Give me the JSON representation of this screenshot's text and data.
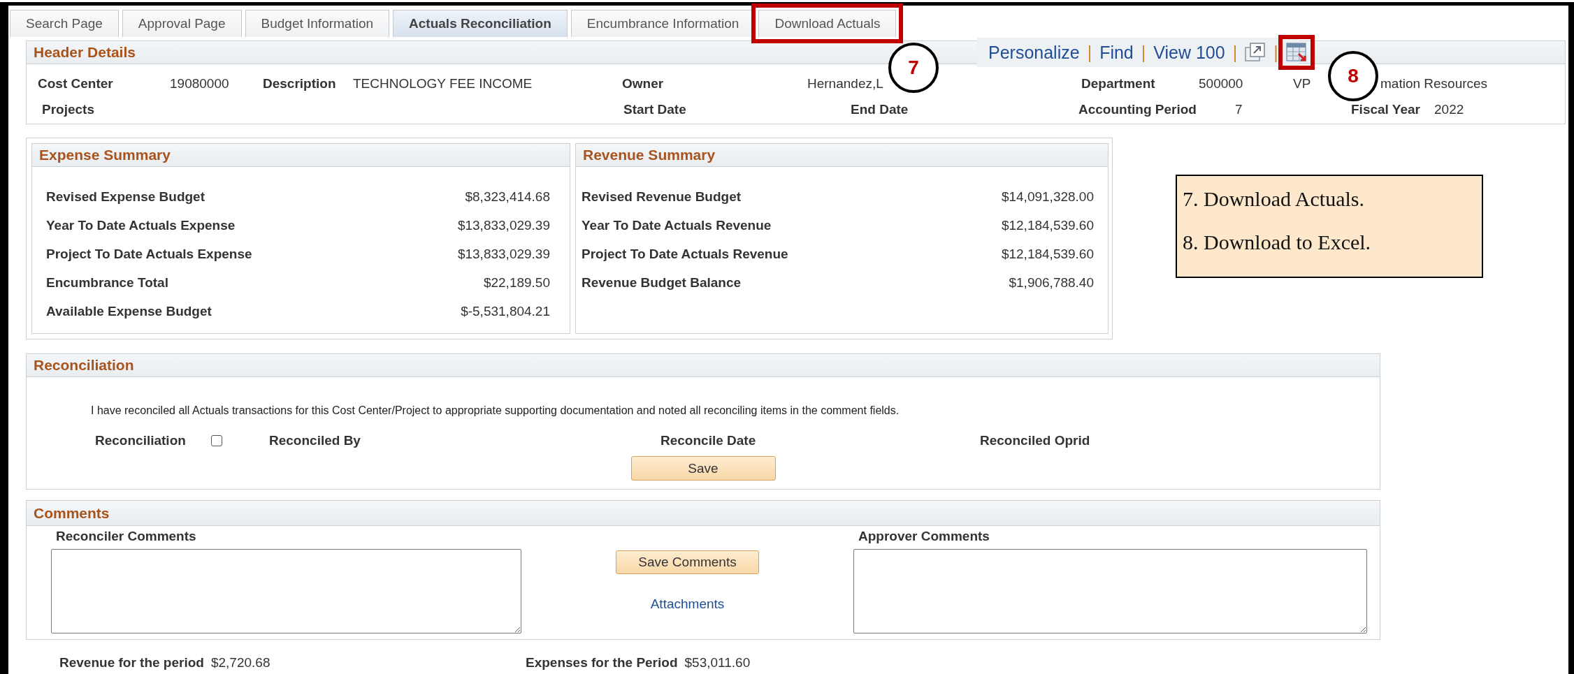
{
  "tabs": [
    {
      "label": "Search Page",
      "selected": false,
      "highlighted": false
    },
    {
      "label": "Approval Page",
      "selected": false,
      "highlighted": false
    },
    {
      "label": "Budget Information",
      "selected": false,
      "highlighted": false
    },
    {
      "label": "Actuals Reconciliation",
      "selected": true,
      "highlighted": false
    },
    {
      "label": "Encumbrance Information",
      "selected": false,
      "highlighted": false
    },
    {
      "label": "Download Actuals",
      "selected": false,
      "highlighted": true
    }
  ],
  "toolbar": {
    "items": [
      {
        "kind": "link",
        "text": "Personalize"
      },
      {
        "kind": "separator",
        "text": "|"
      },
      {
        "kind": "link",
        "text": "Find"
      },
      {
        "kind": "separator",
        "text": "|"
      },
      {
        "kind": "link",
        "text": "View 100"
      },
      {
        "kind": "separator",
        "text": "|"
      },
      {
        "kind": "new_window"
      },
      {
        "kind": "separator",
        "text": "|"
      },
      {
        "kind": "download",
        "highlighted": true
      }
    ]
  },
  "header_details": {
    "title": "Header Details",
    "fields": [
      {
        "label": "Cost Center",
        "value": "19080000"
      },
      {
        "label": "Description",
        "value": "TECHNOLOGY FEE INCOME"
      },
      {
        "label": "Owner",
        "value": "Hernandez,L"
      },
      {
        "label": "Department",
        "value": "500000"
      },
      {
        "value": "VP"
      },
      {
        "value": "mation Resources"
      },
      {
        "label": "Projects"
      },
      {
        "label": "Start Date"
      },
      {
        "label": "End Date"
      },
      {
        "label": "Accounting Period",
        "value": "7"
      },
      {
        "label": "Fiscal Year",
        "value": "2022"
      }
    ]
  },
  "expense_summary": {
    "title": "Expense Summary",
    "rows": [
      {
        "label": "Revised Expense Budget",
        "value": "$8,323,414.68"
      },
      {
        "label": "Year To Date Actuals Expense",
        "value": "$13,833,029.39"
      },
      {
        "label": "Project To Date Actuals Expense",
        "value": "$13,833,029.39"
      },
      {
        "label": "Encumbrance Total",
        "value": "$22,189.50"
      },
      {
        "label": "Available Expense Budget",
        "value": "$-5,531,804.21"
      }
    ]
  },
  "revenue_summary": {
    "title": "Revenue Summary",
    "rows": [
      {
        "label": "Revised Revenue Budget",
        "value": "$14,091,328.00"
      },
      {
        "label": "Year To Date Actuals Revenue",
        "value": "$12,184,539.60"
      },
      {
        "label": "Project To Date Actuals Revenue",
        "value": "$12,184,539.60"
      },
      {
        "label": "Revenue Budget Balance",
        "value": "$1,906,788.40"
      }
    ]
  },
  "reconciliation": {
    "title": "Reconciliation",
    "statement": "I have reconciled all Actuals transactions for this Cost Center/Project to appropriate supporting documentation and noted all reconciling items in the comment fields.",
    "checkbox_label": "Reconciliation",
    "checked": false,
    "labels": [
      "Reconciled By",
      "Reconcile Date",
      "Reconciled Oprid"
    ],
    "save_button": "Save"
  },
  "comments": {
    "title": "Comments",
    "reconciler_label": "Reconciler Comments",
    "approver_label": "Approver Comments",
    "save_button": "Save Comments",
    "attachments_link": "Attachments"
  },
  "footer": [
    {
      "label": "Revenue for the period",
      "value": "$2,720.68"
    },
    {
      "label": "Expenses for the Period",
      "value": "$53,011.60"
    }
  ],
  "annotations": {
    "markers": [
      "7",
      "8"
    ],
    "callout": [
      "7. Download Actuals.",
      "8. Download to Excel."
    ]
  }
}
